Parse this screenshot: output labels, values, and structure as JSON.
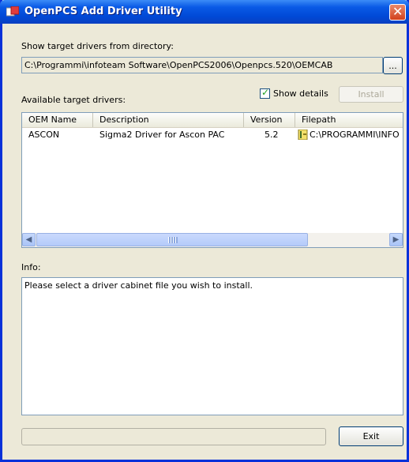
{
  "window": {
    "title": "OpenPCS Add Driver Utility"
  },
  "directory": {
    "label": "Show target drivers from directory:",
    "path": "C:\\Programmi\\infoteam Software\\OpenPCS2006\\Openpcs.520\\OEMCAB",
    "browse_label": "..."
  },
  "drivers": {
    "label": "Available target drivers:",
    "show_details_label": "Show details",
    "show_details_checked": true,
    "install_label": "Install",
    "columns": [
      "OEM Name",
      "Description",
      "Version",
      "Filepath"
    ],
    "rows": [
      {
        "oem": "ASCON",
        "description": "Sigma2 Driver for Ascon PAC",
        "version": "5.2",
        "filepath": "C:\\PROGRAMMI\\INFO"
      }
    ]
  },
  "info": {
    "label": "Info:",
    "text": "Please select a driver cabinet file you wish to install."
  },
  "footer": {
    "exit_label": "Exit"
  },
  "icons": {
    "app": "openpcs-app-icon",
    "close": "close-icon",
    "row_file": "cabinet-file-icon",
    "scroll_left": "scroll-left-icon",
    "scroll_right": "scroll-right-icon"
  },
  "colors": {
    "titlebar": "#0a5ae6",
    "close": "#d2411c",
    "window_bg": "#ece9d8",
    "border": "#7f9db9"
  }
}
